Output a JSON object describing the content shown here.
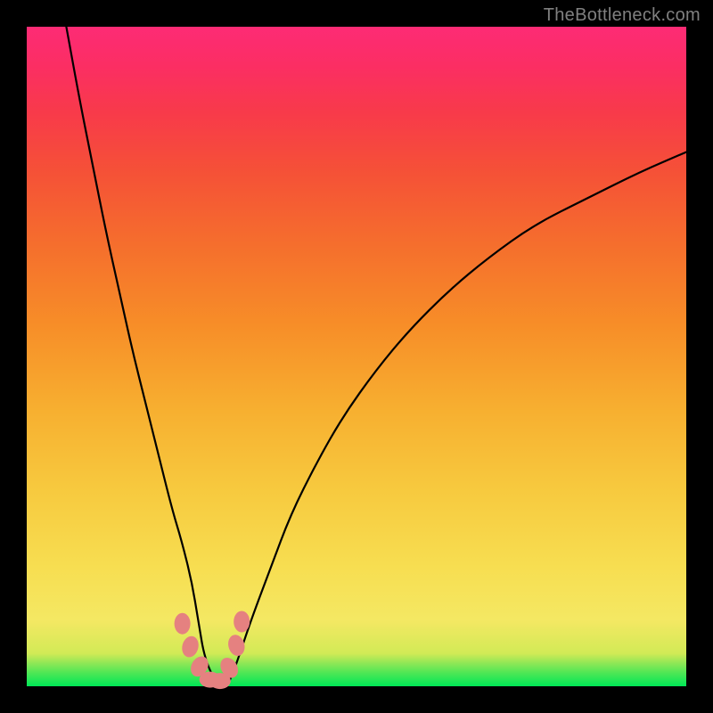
{
  "watermark": "TheBottleneck.com",
  "chart_data": {
    "type": "line",
    "title": "",
    "xlabel": "",
    "ylabel": "",
    "xlim": [
      0,
      100
    ],
    "ylim": [
      0,
      100
    ],
    "grid": false,
    "legend": false,
    "series": [
      {
        "name": "bottleneck-curve",
        "x": [
          6,
          8,
          10,
          12,
          14,
          16,
          18,
          20,
          22,
          23.5,
          25,
          26,
          27,
          29,
          30.5,
          32,
          34,
          37,
          40,
          44,
          48,
          53,
          58,
          64,
          70,
          77,
          85,
          93,
          100
        ],
        "y": [
          100,
          89,
          79,
          69,
          60,
          51,
          43,
          35,
          27,
          22,
          16,
          10,
          4,
          0,
          0,
          4,
          10,
          18,
          26,
          34,
          41,
          48,
          54,
          60,
          65,
          70,
          74,
          78,
          81
        ],
        "note": "Values are read as percentages of the plot area (0=bottom/left, 100=top/right). Curve shows a V-shaped bottleneck profile with minimum near x≈28–30."
      }
    ],
    "annotations": [
      {
        "name": "marker-cluster",
        "x_range": [
          23.5,
          32
        ],
        "y_range": [
          0,
          10
        ],
        "note": "pink rounded markers near the curve minimum"
      }
    ],
    "gradient_stops": [
      {
        "pos": 0.0,
        "color": "#00e756"
      },
      {
        "pos": 0.05,
        "color": "#d2ea56"
      },
      {
        "pos": 0.18,
        "color": "#f7de51"
      },
      {
        "pos": 0.42,
        "color": "#f7af30"
      },
      {
        "pos": 0.67,
        "color": "#f56e2d"
      },
      {
        "pos": 0.87,
        "color": "#f83a4a"
      },
      {
        "pos": 1.0,
        "color": "#fd2b75"
      }
    ]
  }
}
